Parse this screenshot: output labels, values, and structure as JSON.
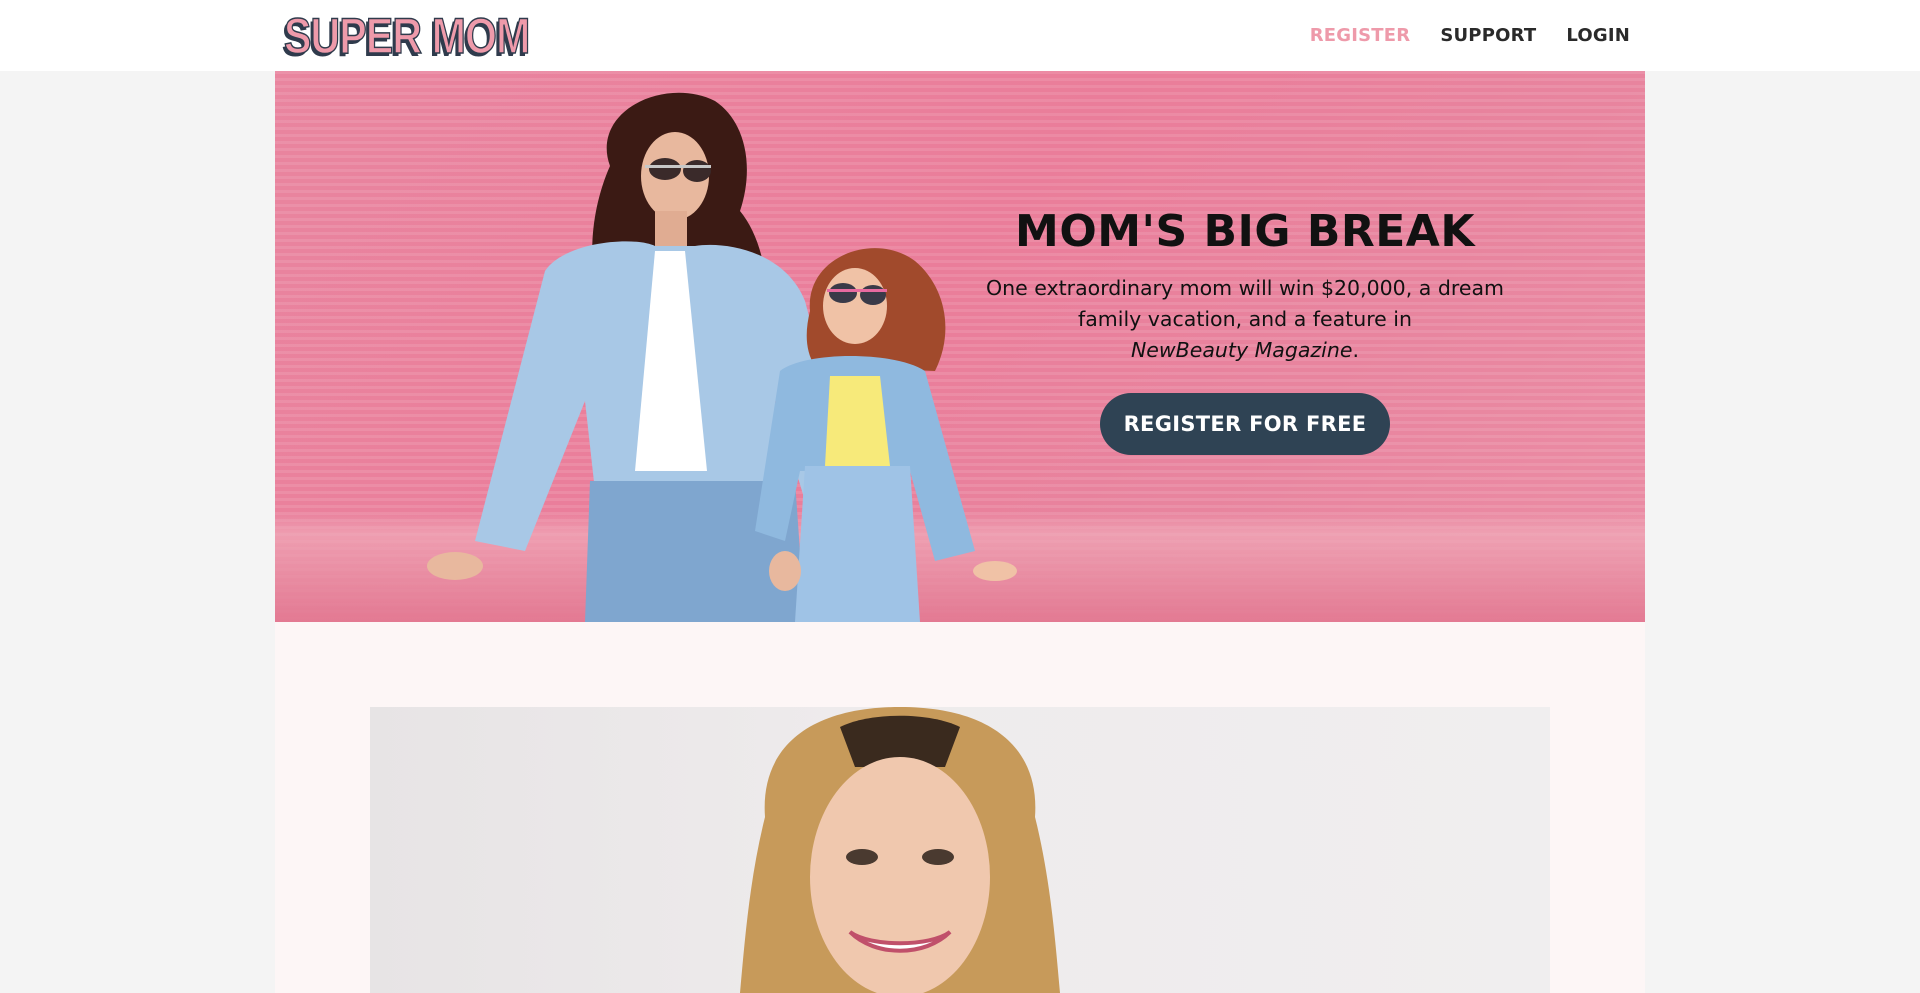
{
  "header": {
    "logo_text": "SUPER MOM",
    "nav": [
      {
        "label": "REGISTER",
        "active": true
      },
      {
        "label": "SUPPORT",
        "active": false
      },
      {
        "label": "LOGIN",
        "active": false
      }
    ]
  },
  "hero": {
    "title": "MOM'S BIG BREAK",
    "text_line1": "One extraordinary mom will win $20,000, a dream",
    "text_line2": "family vacation, and a feature in",
    "magazine": "NewBeauty Magazine",
    "period": ".",
    "cta_label": "REGISTER FOR FREE"
  },
  "colors": {
    "accent_pink": "#ee9aaa",
    "hero_pink": "#e9859f",
    "cta_navy": "#2f4354",
    "text_dark": "#111111",
    "page_bg": "#f4f4f4",
    "section_bg": "#fdf6f6"
  }
}
